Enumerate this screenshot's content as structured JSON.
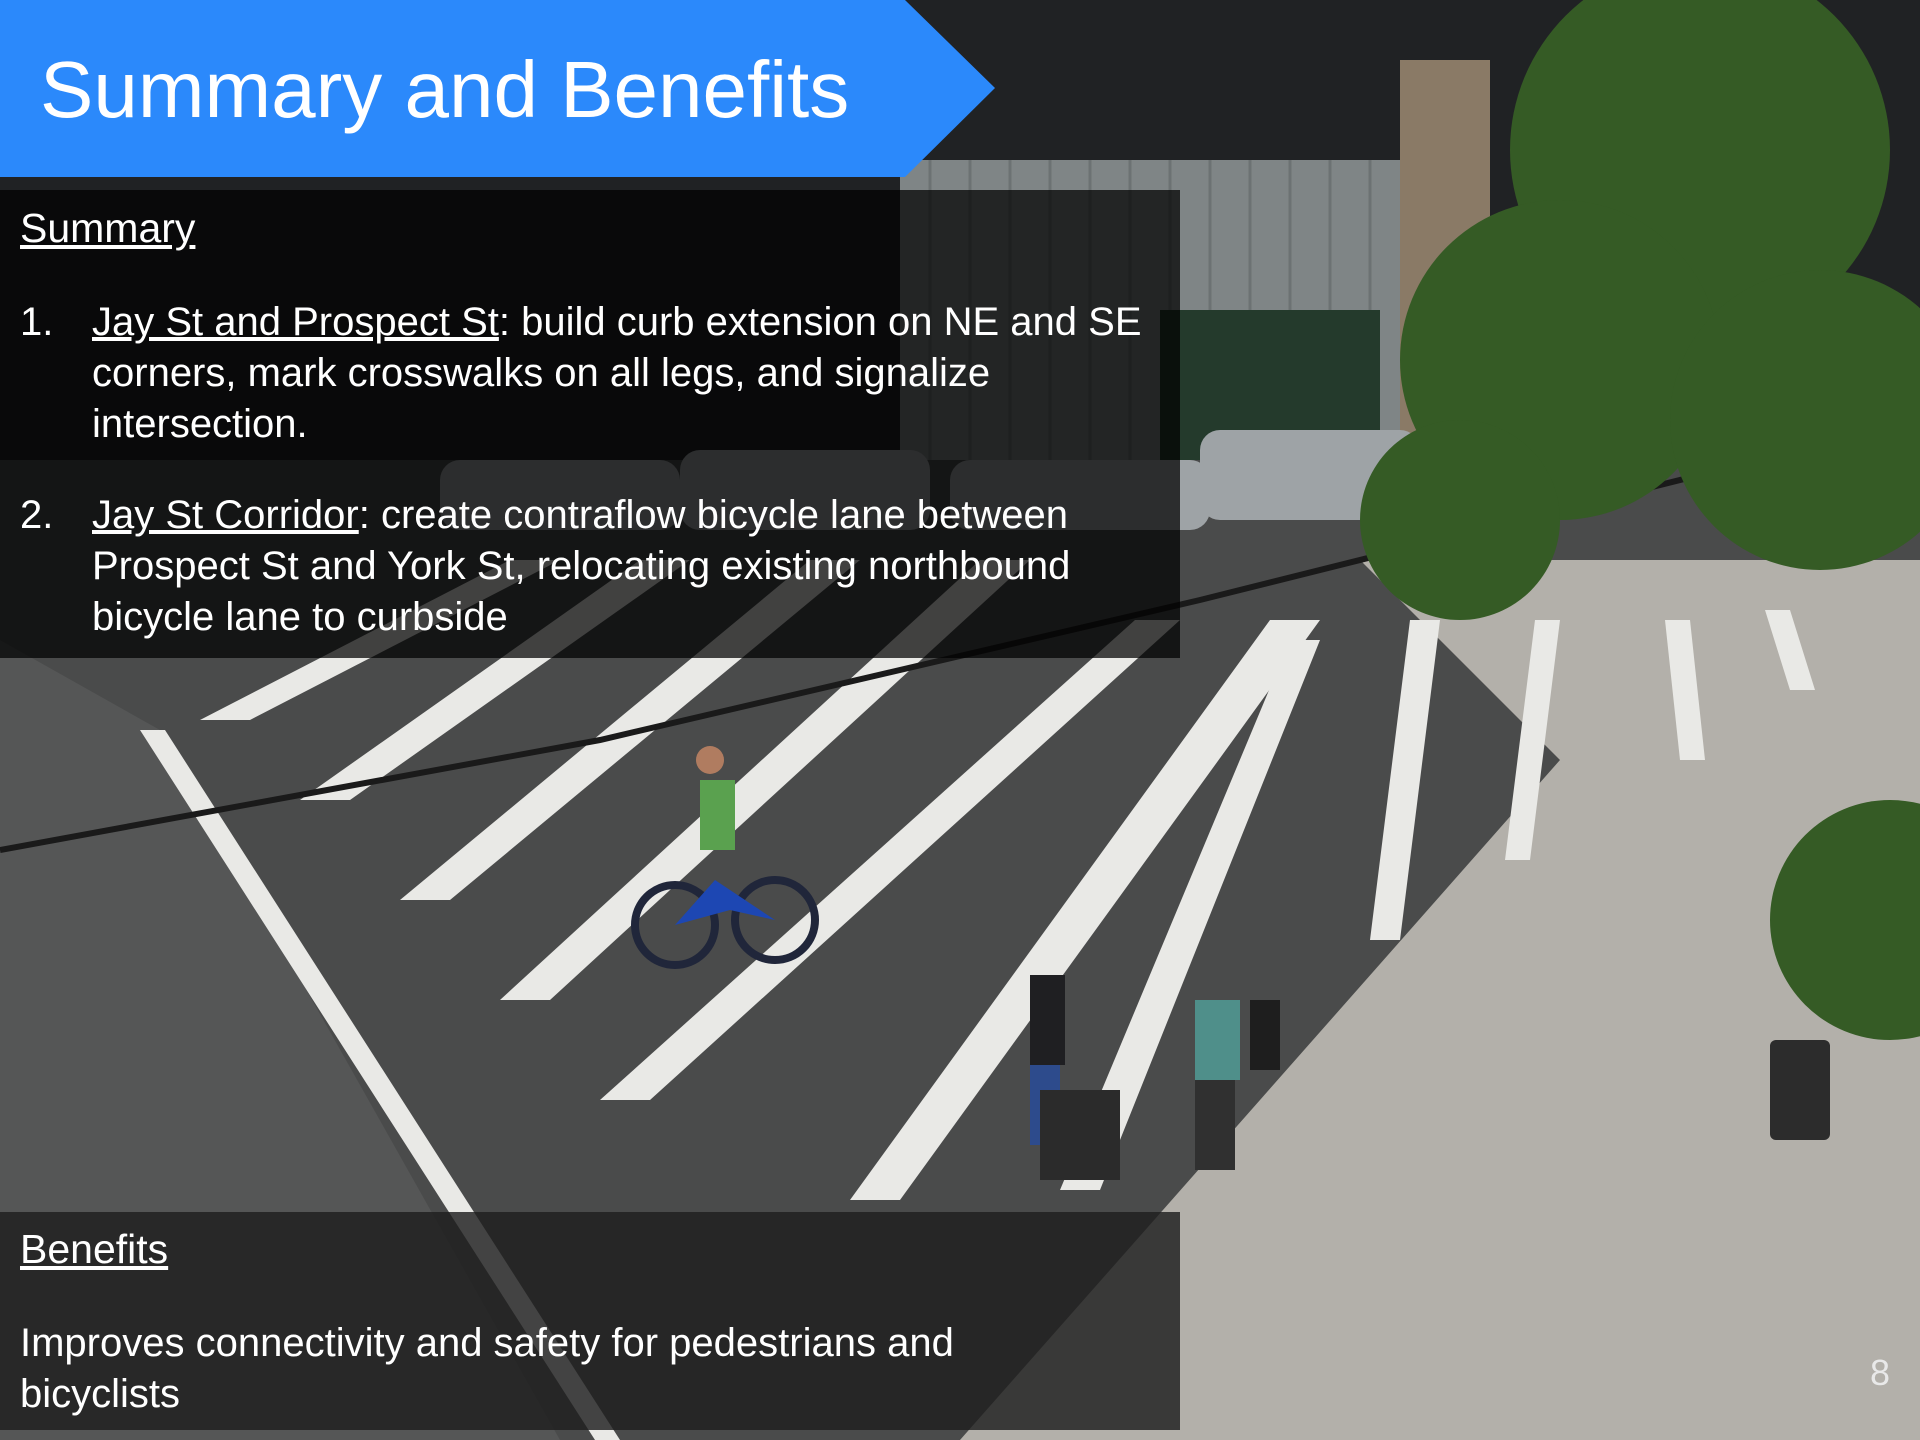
{
  "slide": {
    "title": "Summary and Benefits",
    "page_number": "8",
    "accent_color": "#2b89fb"
  },
  "summary": {
    "heading": "Summary",
    "items": [
      {
        "number": "1.",
        "link_text": "Jay St and Prospect St",
        "text": ": build curb extension on NE and SE corners, mark crosswalks on all legs, and signalize intersection."
      },
      {
        "number": "2.",
        "link_text": "Jay St Corridor",
        "text": ": create contraflow bicycle lane between Prospect St and York St, relocating existing northbound bicycle lane to curbside"
      }
    ]
  },
  "benefits": {
    "heading": "Benefits",
    "text": "Improves connectivity and safety for pedestrians and bicyclists"
  },
  "background_photo": {
    "icon": "street-intersection-photo"
  }
}
